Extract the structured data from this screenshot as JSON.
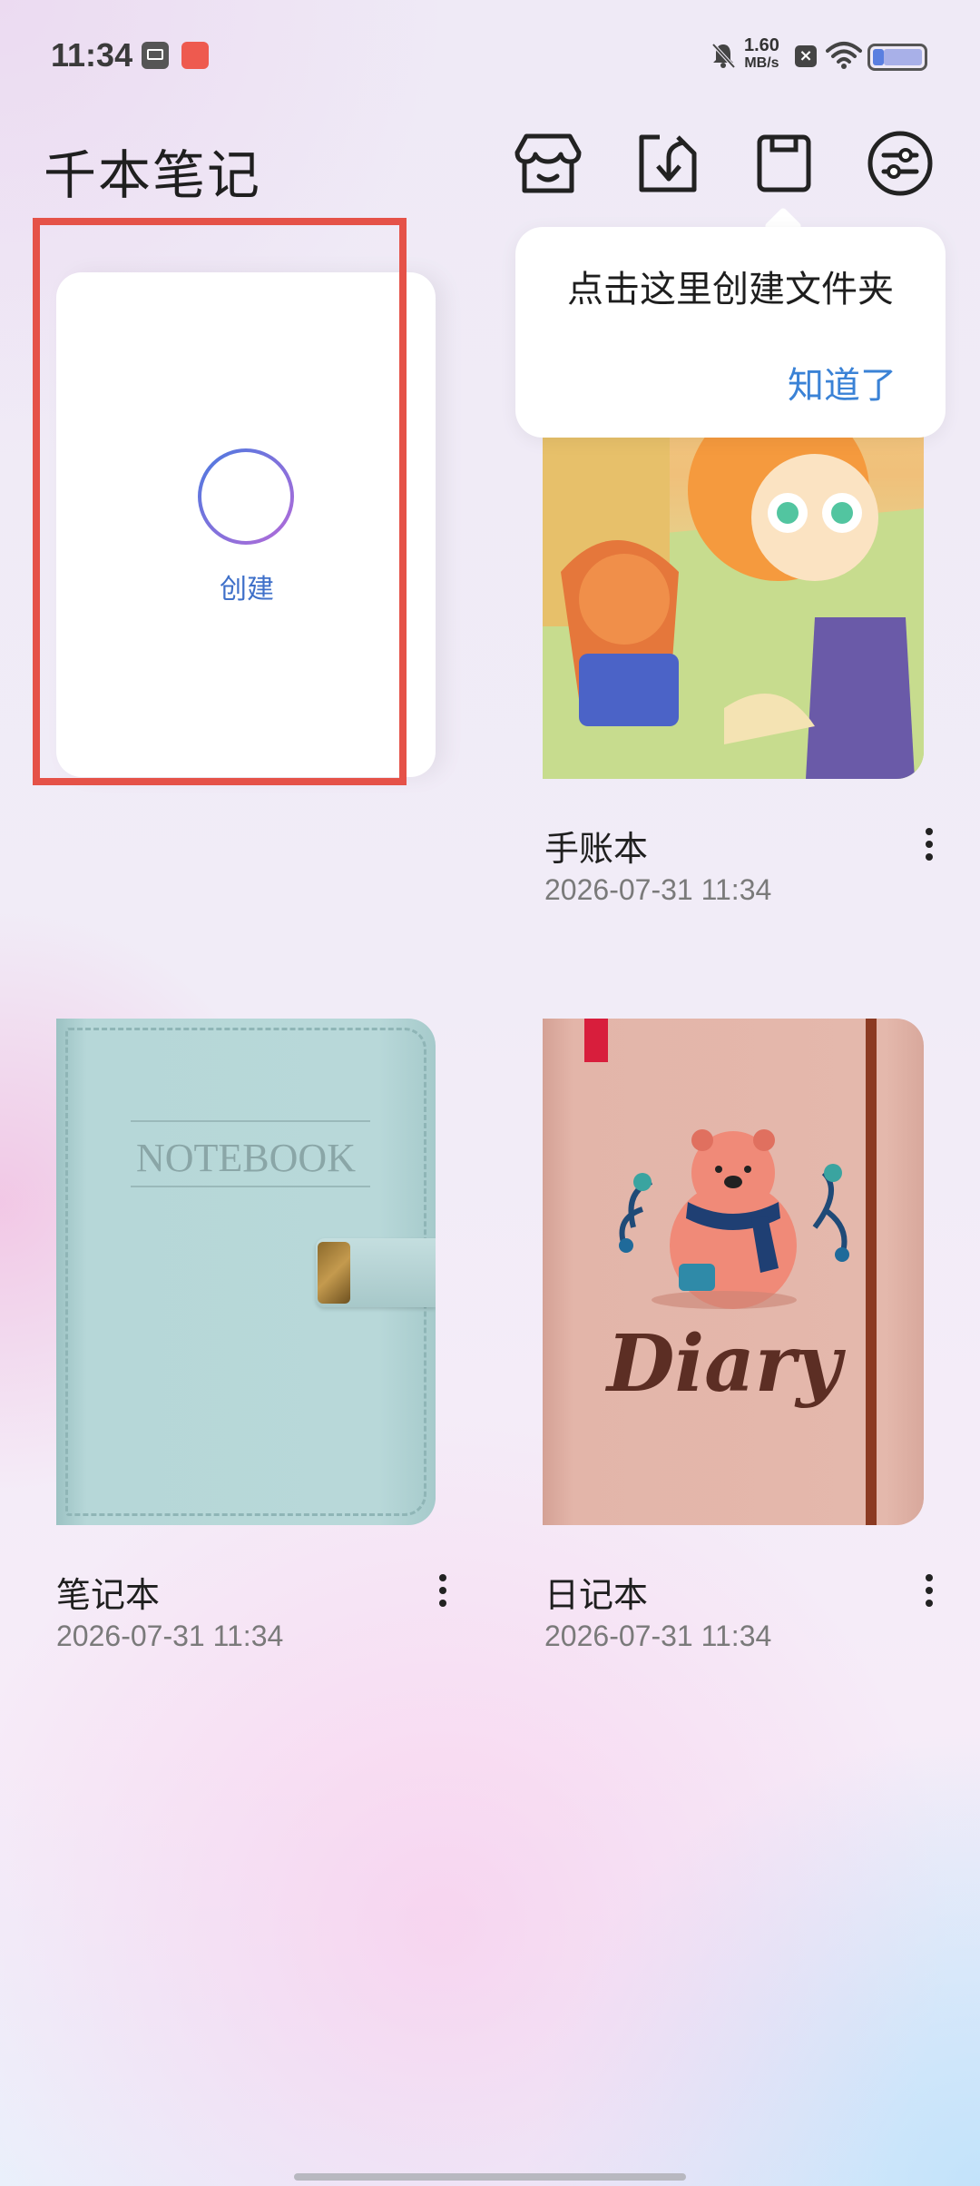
{
  "status_bar": {
    "time": "11:34",
    "net_speed_value": "1.60",
    "net_speed_unit": "MB/s"
  },
  "header": {
    "title": "千本笔记"
  },
  "toolbar": {
    "icons": [
      "shop-icon",
      "import-icon",
      "folder-save-icon",
      "settings-sliders-icon"
    ]
  },
  "create_card": {
    "label": "创建"
  },
  "tooltip": {
    "text": "点击这里创建文件夹",
    "ok_label": "知道了"
  },
  "notebooks": [
    {
      "title": "手账本",
      "date": "2026-07-31 11:34",
      "cover": "cartoon-illustration-cover"
    },
    {
      "title": "笔记本",
      "date": "2026-07-31 11:34",
      "cover": "teal-leather-notebook-cover",
      "cover_text": "NOTEBOOK"
    },
    {
      "title": "日记本",
      "date": "2026-07-31 11:34",
      "cover": "pink-bear-diary-cover",
      "cover_text": "Diary"
    }
  ],
  "colors": {
    "accent_blue": "#3a82d6",
    "highlight_red": "#e55248",
    "notebook_teal": "#b5d6d7",
    "diary_pink": "#e2b3a7"
  }
}
